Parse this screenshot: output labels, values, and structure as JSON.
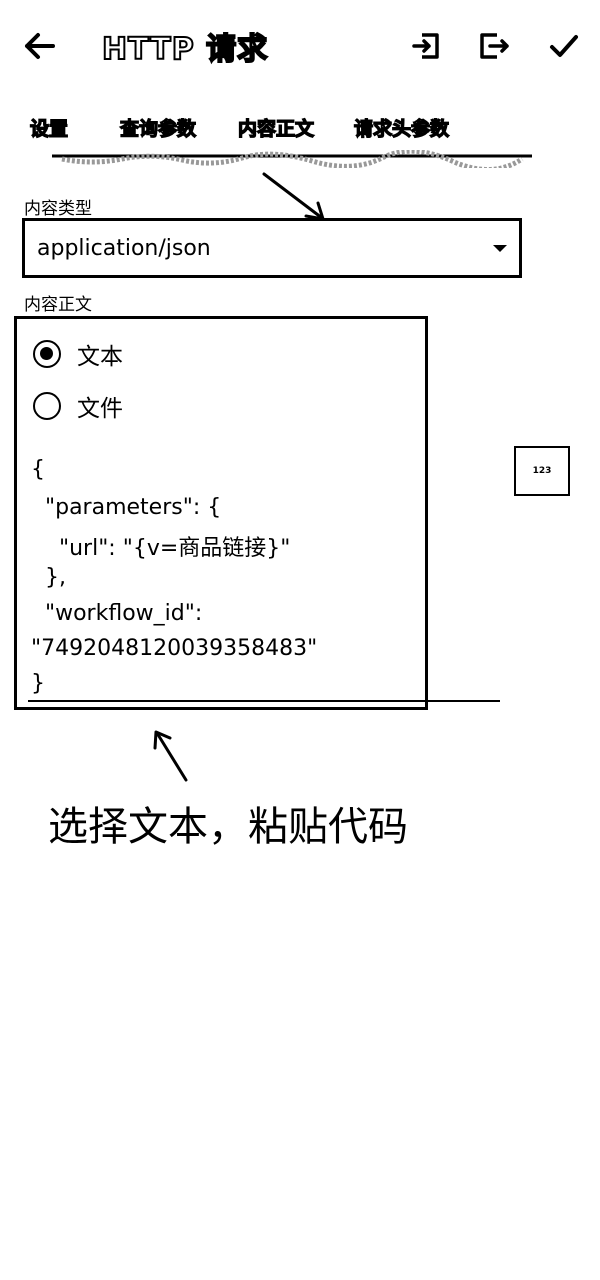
{
  "appbar": {
    "title": "HTTP 请求",
    "back_icon": "arrow-left-icon",
    "import_icon": "import-icon",
    "export_icon": "export-icon",
    "save_icon": "checkmark-icon"
  },
  "tabs": [
    {
      "label": "设置"
    },
    {
      "label": "查询参数"
    },
    {
      "label": "内容正文",
      "selected": true
    },
    {
      "label": "请求头参数"
    }
  ],
  "content_type": {
    "label": "内容类型",
    "value": "application/json"
  },
  "body": {
    "label": "内容正文",
    "options": [
      {
        "label": "文本",
        "checked": true
      },
      {
        "label": "文件",
        "checked": false
      }
    ],
    "code_lines": [
      "{",
      "  \"parameters\": {",
      "    \"url\": \"{v=商品链接}\"",
      "  },",
      "  \"workflow_id\":",
      "\"7492048120039358483\"",
      "}"
    ]
  },
  "side_button": {
    "label": "123",
    "icon": "keyboard-icon"
  },
  "annotation": {
    "text": "选择文本，粘贴代码"
  }
}
